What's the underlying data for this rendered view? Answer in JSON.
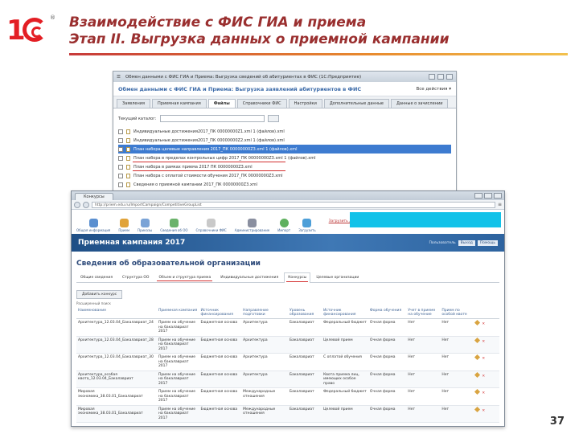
{
  "slide": {
    "title_line1": "Взаимодействие с ФИС ГИА и приема",
    "title_line2": "Этап II. Выгрузка данных о приемной кампании",
    "page_number": "37",
    "logo": "1С",
    "accent_color": "#9a2f2f"
  },
  "window_back": {
    "titlebar": "Обмен данными с ФИС ГИА и Приема: Выгрузка сведений об абитуриентах в ФИС  (1С:Предприятие)",
    "header_title": "Обмен данными с ФИС ГИА и Приема: Выгрузка заявлений абитуриентов в ФИС",
    "all_actions": "Все действия ▾",
    "tabs": [
      "Заявления",
      "Приемная кампания",
      "Файлы",
      "Справочники ФИС",
      "Настройки",
      "Дополнительные данные",
      "Данные о зачислении"
    ],
    "directory_label": "Текущий каталог:",
    "files": [
      "Индивидуальные достижения2017_ПК 00000000Z1.xml 1 (файлов).xml",
      "Индивидуальные достижения2017_ПК 00000000Z2.xml 1 (файлов).xml",
      "План набора целевые направления 2017_ПК 00000000Z3.xml 1 (файлов).xml",
      "План набора в пределах контрольных цифр 2017_ПК 00000000Z3.xml 1 (файлов).xml",
      "План набора в рамках приема 2017 ПК 00000000Z3.xml",
      "План набора с оплатой стоимости обучения 2017_ПК 00000000Z3.xml",
      "Сведения о приемной кампании 2017_ПК 00000000Z3.xml"
    ]
  },
  "window_front": {
    "browser_tab": "Конкурсы",
    "url": "http://priem.edu.ru/ImportCampaign/CompetitiveGroupList",
    "toolbar": [
      "Общая информация",
      "Прием",
      "Приказы",
      "Сведения об ОО",
      "Справочники ФИС",
      "Администрирование",
      "Импорт",
      "Загрузить"
    ],
    "toolbar_note": "Загрузить данные о приемной кампании с помощью файла",
    "banner_title": "Приемная кампания 2017",
    "banner_user": "Пользователь",
    "banner_btn1": "Выход",
    "banner_btn2": "Помощь",
    "org_title": "Сведения об образовательной организации",
    "tabs": [
      "Общие сведения",
      "Структура ОО",
      "Объем и структура приема",
      "Индивидуальные достижения",
      "Конкурсы",
      "Целевые организации"
    ],
    "active_tab": "Конкурсы",
    "add_button": "Добавить конкурс",
    "advanced_search": "Расширенный поиск",
    "columns": [
      "Наименование",
      "Приемная кампания",
      "Источник финансирования",
      "Направление подготовки",
      "Уровень образования",
      "Источник финансирования",
      "Форма обучения",
      "Учет в приеме на обучение",
      "Прием по особой квоте"
    ],
    "rows": [
      [
        "Архитектура_12.03.04_Бакалавриат_24",
        "Прием на обучение на бакалавриат 2017",
        "Бюджетная основа",
        "Архитектура",
        "Бакалавриат",
        "Федеральный бюджет",
        "Очная форма",
        "Нет",
        "Нет"
      ],
      [
        "Архитектура_12.03.04_Бакалавриат_28",
        "Прием на обучение на бакалавриат 2017",
        "Бюджетная основа",
        "Архитектура",
        "Бакалавриат",
        "Целевой прием",
        "Очная форма",
        "Нет",
        "Нет"
      ],
      [
        "Архитектура_12.03.04_Бакалавриат_30",
        "Прием на обучение на бакалавриат 2017",
        "Бюджетная основа",
        "Архитектура",
        "Бакалавриат",
        "С оплатой обучения",
        "Очная форма",
        "Нет",
        "Нет"
      ],
      [
        "Архитектура_особая квота_12.03.04_Бакалавриат",
        "Прием на обучение на бакалавриат 2017",
        "Бюджетная основа",
        "Архитектура",
        "Бакалавриат",
        "Квота приема лиц, имеющих особое право",
        "Очная форма",
        "Нет",
        "Нет"
      ],
      [
        "Мировая экономика_38.03.01_Бакалавриат",
        "Прием на обучение на бакалавриат 2017",
        "Бюджетная основа",
        "Международные отношения",
        "Бакалавриат",
        "Федеральный бюджет",
        "Очная форма",
        "Нет",
        "Нет"
      ],
      [
        "Мировая экономика_38.03.01_Бакалавриат",
        "Прием на обучение на бакалавриат 2017",
        "Бюджетная основа",
        "Международные отношения",
        "Бакалавриат",
        "Целевой прием",
        "Очная форма",
        "Нет",
        "Нет"
      ]
    ]
  }
}
